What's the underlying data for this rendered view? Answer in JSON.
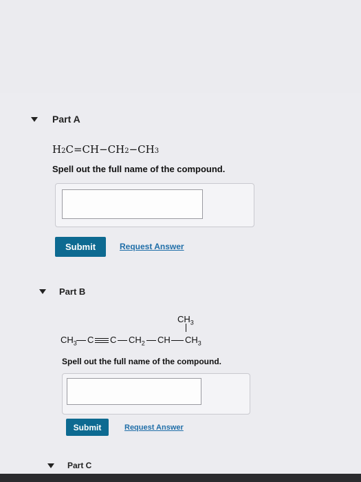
{
  "parts": [
    {
      "title": "Part A",
      "formula": {
        "tokens": [
          "H",
          "2",
          "C=CH−CH",
          "2",
          "−CH",
          "3"
        ]
      },
      "prompt": "Spell out the full name of the compound.",
      "answer_value": "",
      "submit_label": "Submit",
      "request_label": "Request Answer"
    },
    {
      "title": "Part B",
      "structure": {
        "branch": "CH3",
        "chain": [
          "CH3",
          "C",
          "C",
          "CH2",
          "CH",
          "CH3"
        ]
      },
      "prompt": "Spell out the full name of the compound.",
      "answer_value": "",
      "submit_label": "Submit",
      "request_label": "Request Answer"
    },
    {
      "title": "Part C"
    }
  ],
  "colors": {
    "submit_bg": "#0d6a91",
    "link": "#1f6ea8",
    "background": "#ececf0"
  }
}
